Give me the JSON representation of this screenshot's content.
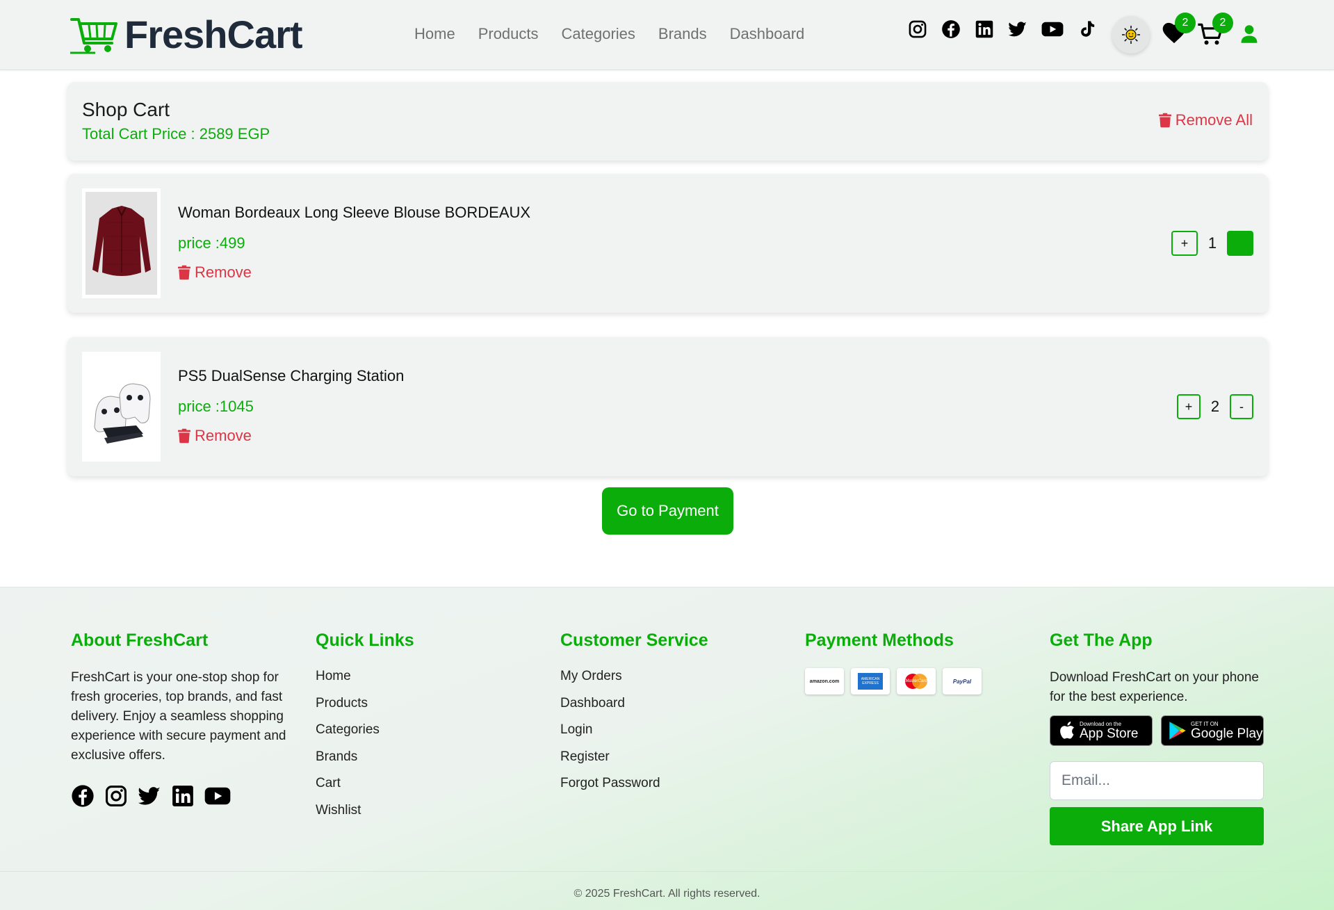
{
  "navbar": {
    "brand": "FreshCart",
    "links": [
      "Home",
      "Products",
      "Categories",
      "Brands",
      "Dashboard"
    ],
    "social_icons": [
      "instagram-icon",
      "facebook-icon",
      "linkedin-icon",
      "twitter-icon",
      "youtube-icon",
      "tiktok-icon"
    ],
    "wishlist_count": "2",
    "cart_count": "2",
    "accent_color": "#0aad0a"
  },
  "cart": {
    "title": "Shop Cart",
    "total_label": "Total Cart Price : 2589 EGP",
    "remove_all_label": "Remove All",
    "items": [
      {
        "name": "Woman Bordeaux Long Sleeve Blouse BORDEAUX",
        "price_label": "price :499",
        "remove_label": "Remove",
        "qty": "1",
        "plus": "+",
        "minus": ""
      },
      {
        "name": "PS5 DualSense Charging Station",
        "price_label": "price :1045",
        "remove_label": "Remove",
        "qty": "2",
        "plus": "+",
        "minus": "-"
      }
    ],
    "payment_button": "Go to Payment"
  },
  "footer": {
    "about": {
      "title": "About FreshCart",
      "text": "FreshCart is your one-stop shop for fresh groceries, top brands, and fast delivery. Enjoy a seamless shopping experience with secure payment and exclusive offers."
    },
    "quick_links": {
      "title": "Quick Links",
      "items": [
        "Home",
        "Products",
        "Categories",
        "Brands",
        "Cart",
        "Wishlist"
      ]
    },
    "customer_service": {
      "title": "Customer Service",
      "items": [
        "My Orders",
        "Dashboard",
        "Login",
        "Register",
        "Forgot Password"
      ]
    },
    "payment_methods": {
      "title": "Payment Methods",
      "cards": [
        "amazon.com",
        "AMERICAN EXPRESS",
        "MasterCard",
        "PayPal"
      ]
    },
    "app": {
      "title": "Get The App",
      "text": "Download FreshCart on your phone for the best experience.",
      "appstore_small": "Download on the",
      "appstore_big": "App Store",
      "googleplay_small": "GET IT ON",
      "googleplay_big": "Google Play",
      "email_placeholder": "Email...",
      "share_button": "Share App Link"
    },
    "copyright": "© 2025 FreshCart. All rights reserved."
  }
}
